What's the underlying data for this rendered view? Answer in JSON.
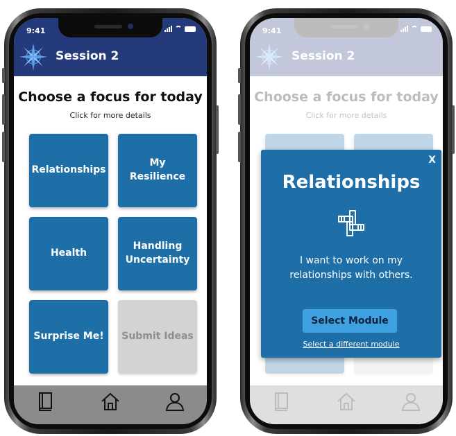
{
  "status_time": "9:41",
  "header": {
    "title": "Session 2"
  },
  "main": {
    "title": "Choose a focus for today",
    "subtitle": "Click for more details",
    "tiles": [
      {
        "label": "Relationships"
      },
      {
        "label": "My\nResilience"
      },
      {
        "label": "Health"
      },
      {
        "label": "Handling\nUncertainty"
      },
      {
        "label": "Surprise Me!"
      },
      {
        "label": "Submit Ideas"
      }
    ]
  },
  "modal": {
    "close_label": "X",
    "title": "Relationships",
    "description": "I want to work on my\nrelationships with others.",
    "button_label": "Select Module",
    "link_label": "Select a different module"
  },
  "tabbar": {
    "items": [
      "book-icon",
      "home-icon",
      "profile-icon"
    ]
  },
  "colors": {
    "header": "#243a7a",
    "tile": "#1e6ea7",
    "tile_disabled": "#d3d3d3",
    "tabbar": "#8b8b8b",
    "modal_button": "#3fa2e0"
  }
}
